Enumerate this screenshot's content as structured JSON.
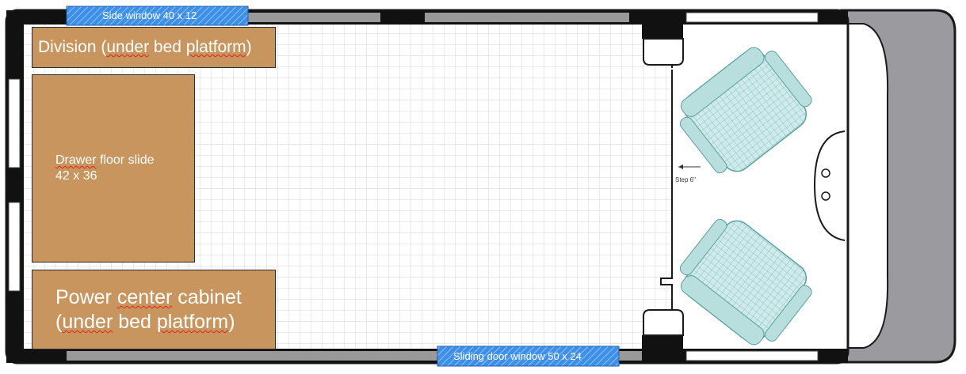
{
  "boxes": {
    "division": {
      "line1": "Division (",
      "under": "under",
      "mid": " bed ",
      "platform": "platform",
      "end": ")"
    },
    "drawer": {
      "word1": "Drawer",
      "word2": " floor slide",
      "dims": "42 x 36"
    },
    "power": {
      "line1_a": "Power ",
      "line1_b": "center",
      "line1_c": " cabinet",
      "line2_a": "(",
      "line2_b": "under",
      "line2_c": " bed ",
      "line2_d": "platform",
      "line2_e": ")"
    }
  },
  "windows": {
    "side": "Side window 40 x 12",
    "sliding": "Sliding door window 50 x 24"
  },
  "annotations": {
    "step": "Step 6\""
  },
  "colors": {
    "cabinet_fill": "#c9955e",
    "window_blue": "#3d8fe8",
    "van_outline": "#1a1a1a",
    "hood_gray": "#9b9b9f",
    "seat_fill": "#cfeaea",
    "grid_line": "#d6d6d6",
    "squiggle_red": "#e0201b"
  },
  "icons": [
    "seat-icon",
    "step-arrow-icon",
    "door-handle-icon"
  ]
}
